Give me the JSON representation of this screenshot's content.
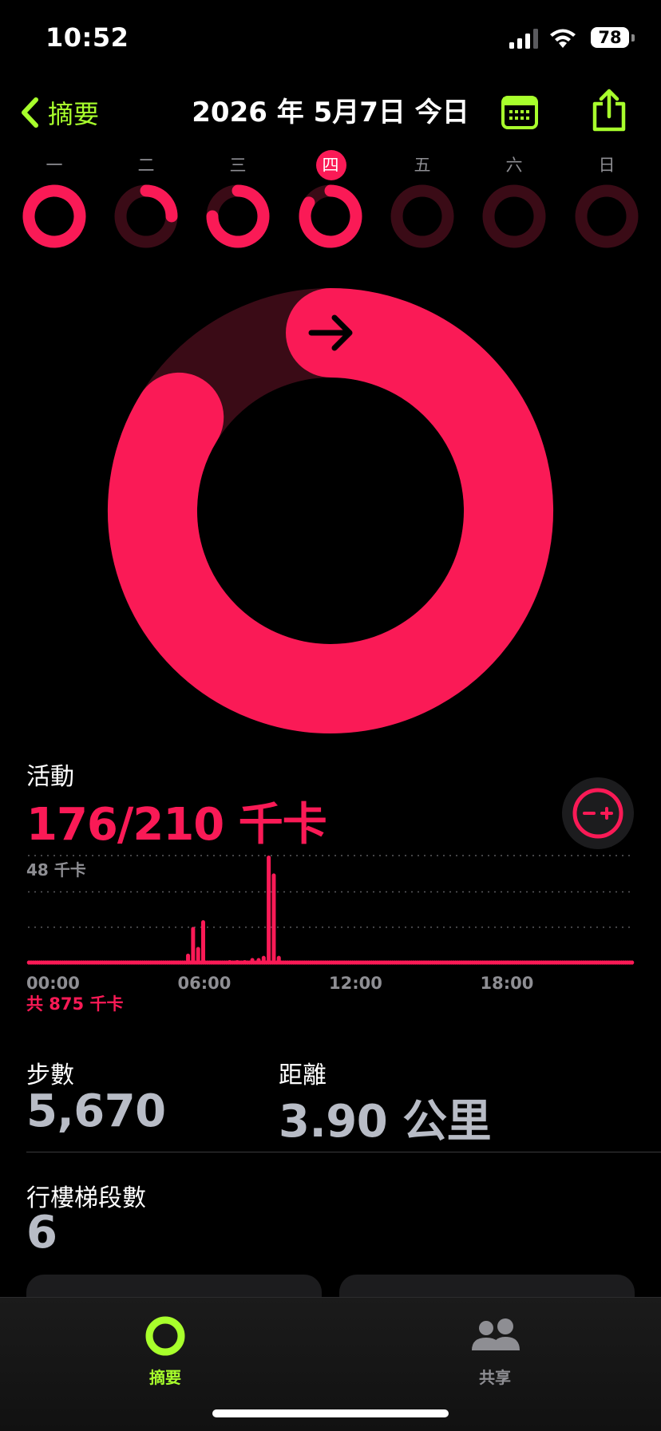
{
  "status": {
    "time": "10:52",
    "battery": "78"
  },
  "nav": {
    "back_label": "摘要",
    "title": "2026 年 5月7日 今日"
  },
  "week": [
    {
      "label": "一",
      "progress": 0.99,
      "today": false
    },
    {
      "label": "二",
      "progress": 0.25,
      "today": false
    },
    {
      "label": "三",
      "progress": 0.75,
      "today": false
    },
    {
      "label": "四",
      "progress": 0.84,
      "today": true
    },
    {
      "label": "五",
      "progress": 0,
      "today": false
    },
    {
      "label": "六",
      "progress": 0,
      "today": false
    },
    {
      "label": "日",
      "progress": 0,
      "today": false
    }
  ],
  "ring": {
    "progress": 0.838
  },
  "activity": {
    "title": "活動",
    "value": "176/210 千卡",
    "total": "共 875 千卡"
  },
  "chart_data": {
    "type": "bar",
    "ylabel": "48 千卡",
    "ylim": [
      0,
      48
    ],
    "xticks": [
      "00:00",
      "06:00",
      "12:00",
      "18:00"
    ],
    "bins_per_hour": 4,
    "values": [
      0,
      0,
      0,
      0,
      0,
      0,
      0,
      0,
      0,
      0,
      0,
      0,
      0,
      0,
      0,
      0,
      0,
      0,
      0,
      0,
      0,
      0,
      0,
      0,
      0,
      0,
      0,
      0,
      0,
      0,
      0,
      0,
      0,
      0,
      0,
      0,
      0,
      0,
      0,
      0,
      0,
      0,
      0,
      0,
      0,
      0,
      0,
      0,
      0,
      0,
      0,
      0,
      0,
      0,
      0,
      0,
      0,
      0,
      0,
      0,
      0,
      0,
      0,
      0,
      0,
      0,
      0,
      0,
      0,
      0,
      0,
      0,
      0,
      0,
      0,
      0,
      0,
      0,
      0,
      0,
      0,
      0,
      0,
      0,
      0,
      0,
      0,
      0,
      0,
      0,
      0,
      0,
      0,
      0,
      0,
      0,
      0,
      0,
      0,
      0,
      0,
      0,
      0,
      0,
      0,
      0,
      0,
      0,
      0,
      0,
      0,
      0,
      0,
      0,
      0,
      0,
      0,
      0,
      0,
      0,
      0,
      0,
      0,
      0,
      0,
      0,
      0,
      0,
      0,
      0,
      0,
      0,
      0,
      0,
      0,
      0,
      0,
      0,
      0,
      0,
      0,
      0,
      0,
      0,
      0,
      0,
      0,
      0,
      0,
      0,
      0,
      0,
      0,
      0,
      0,
      0,
      0,
      0,
      0,
      0,
      0,
      0,
      0,
      0,
      0,
      0,
      0,
      0,
      0,
      0,
      0,
      0,
      0,
      0,
      0,
      0,
      0,
      0,
      0,
      0,
      0,
      0,
      0,
      0,
      0,
      0,
      0,
      0,
      0,
      0,
      0,
      0,
      0,
      0,
      0,
      0,
      0,
      0,
      0,
      0,
      0,
      0,
      0,
      0,
      0,
      0,
      0,
      0,
      0,
      0,
      0,
      0,
      0,
      0,
      0,
      0,
      0,
      0,
      0,
      0,
      0,
      0,
      0,
      0,
      0,
      0,
      0,
      0,
      0,
      0,
      0,
      0,
      0,
      0,
      0,
      0,
      0,
      0,
      0,
      0,
      0,
      0,
      0,
      0,
      0,
      0,
      0,
      0,
      0,
      0,
      0,
      0,
      0,
      0,
      0,
      0,
      0,
      0,
      0,
      0,
      0,
      0,
      0,
      0,
      0,
      0,
      0,
      0,
      0,
      0,
      0,
      0,
      0,
      0,
      0,
      0,
      0,
      0,
      0,
      0,
      0,
      0,
      0,
      0,
      0,
      0,
      0,
      0
    ],
    "bars": [
      {
        "hour": 6.35,
        "value": 4
      },
      {
        "hour": 6.55,
        "value": 16
      },
      {
        "hour": 6.75,
        "value": 7
      },
      {
        "hour": 6.95,
        "value": 19
      },
      {
        "hour": 8.0,
        "value": 1
      },
      {
        "hour": 8.3,
        "value": 1
      },
      {
        "hour": 8.6,
        "value": 1
      },
      {
        "hour": 8.9,
        "value": 2
      },
      {
        "hour": 9.15,
        "value": 2
      },
      {
        "hour": 9.35,
        "value": 3
      },
      {
        "hour": 9.55,
        "value": 48
      },
      {
        "hour": 9.75,
        "value": 40
      },
      {
        "hour": 9.95,
        "value": 3
      }
    ]
  },
  "stats": {
    "steps_label": "步數",
    "steps_value": "5,670",
    "distance_label": "距離",
    "distance_value": "3.90 公里",
    "flights_label": "行樓梯段數",
    "flights_value": "6"
  },
  "tabs": [
    {
      "label": "摘要",
      "active": true
    },
    {
      "label": "共享",
      "active": false
    }
  ],
  "colors": {
    "move": "#fa1a56",
    "move_track": "#3a0b16",
    "accent": "#a8ff2c"
  }
}
